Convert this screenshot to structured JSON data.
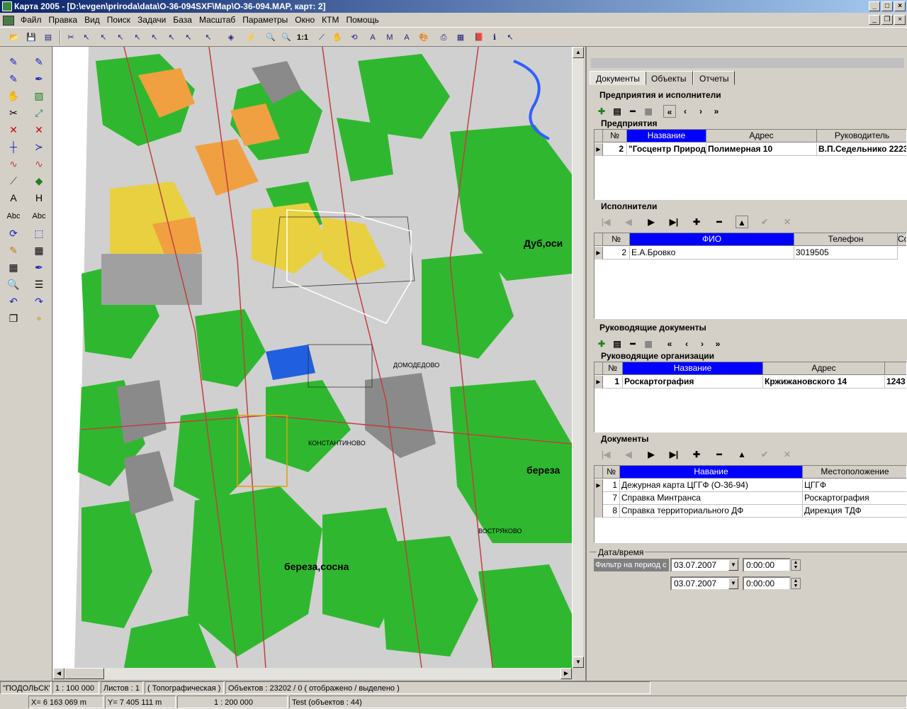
{
  "window": {
    "title": "Карта 2005 - [D:\\evgen\\priroda\\data\\O-36-094SXF\\Map\\O-36-094.MAP, карт: 2]"
  },
  "menu": [
    "Файл",
    "Правка",
    "Вид",
    "Поиск",
    "Задачи",
    "База",
    "Масштаб",
    "Параметры",
    "Окно",
    "КТМ",
    "Помощь"
  ],
  "toolbar": {
    "zoom_label": "1:1"
  },
  "map": {
    "labels": {
      "dub": "Дуб,оси",
      "bereza1": "береза",
      "bereza2": "береза,сосна",
      "vostryakovo": "ВОСТРЯКОВО",
      "domodedovo": "ДОМОДЕДОВО",
      "kuzmino": "КОНСТАНТИНОВО"
    }
  },
  "panel": {
    "tabs": [
      "Документы",
      "Объекты",
      "Отчеты"
    ],
    "enterprises_group": "Предприятия и исполнители",
    "enterprises_title": "Предприятия",
    "enterprises_cols": [
      "№",
      "Название",
      "Адрес",
      "Руководитель"
    ],
    "enterprises_rows": [
      {
        "n": "2",
        "name": "\"Госцентр Природ",
        "addr": "Полимерная 10",
        "head": "В.П.Седельнико 2223"
      }
    ],
    "executors_title": "Исполнители",
    "executors_cols": [
      "№",
      "ФИО",
      "Телефон",
      "Со"
    ],
    "executors_rows": [
      {
        "n": "2",
        "fio": "Е.А.Бровко",
        "phone": "3019505"
      }
    ],
    "guide_group": "Руководящие документы",
    "guide_orgs_title": "Руководящие организации",
    "guide_cols": [
      "№",
      "Название",
      "Адрес"
    ],
    "guide_rows": [
      {
        "n": "1",
        "name": "Роскартография",
        "addr": "Кржижановского 14",
        "extra": "1243"
      }
    ],
    "docs_title": "Документы",
    "docs_cols": [
      "№",
      "Навание",
      "Местоположение"
    ],
    "docs_rows": [
      {
        "n": "1",
        "name": "Дежурная карта ЦГГФ (О-36-94)",
        "loc": "ЦГГФ"
      },
      {
        "n": "7",
        "name": "Справка Минтранса",
        "loc": "Роскартография"
      },
      {
        "n": "8",
        "name": "Справка территориального ДФ",
        "loc": "Дирекция ТДФ"
      }
    ],
    "date_group": "Дата/время",
    "filter_label": "Фильтр на период с",
    "date1": "03.07.2007",
    "time1": "0:00:00",
    "date2": "03.07.2007",
    "time2": "0:00:00"
  },
  "status": {
    "name": "\"ПОДОЛЬСК\"",
    "scale": "1 : 100 000",
    "sheets": "Листов : 1",
    "type": "( Топографическая )",
    "objects": "Объектов : 23202 / 0  ( отображено / выделено )",
    "x": "X=    6 163 069 m",
    "y": "Y=    7 405 111 m",
    "scale2": "1 : 200 000",
    "test": "Test   (объектов : 44)"
  },
  "colors": {
    "forest": "#2fb82f",
    "field": "#d8d8d8",
    "urban": "#f0a040",
    "road": "#c04040",
    "select": "#0000ff"
  }
}
